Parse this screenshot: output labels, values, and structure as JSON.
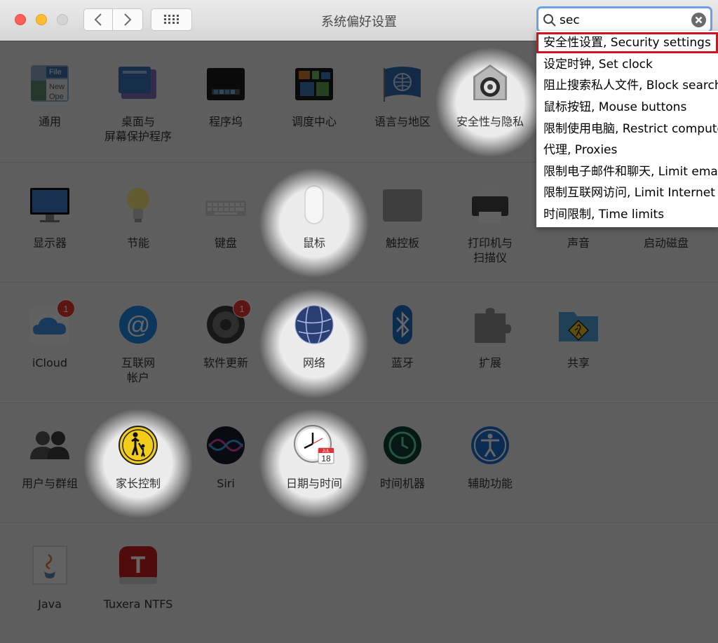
{
  "window": {
    "title": "系统偏好设置"
  },
  "search": {
    "value": "sec"
  },
  "results": [
    "安全性设置, Security settings",
    "设定时钟, Set clock",
    "阻止搜索私人文件, Block searches of private files",
    "鼠标按钮, Mouse buttons",
    "限制使用电脑, Restrict computer use",
    "代理, Proxies",
    "限制电子邮件和聊天, Limit email and chat",
    "限制互联网访问, Limit Internet access",
    "时间限制, Time limits"
  ],
  "rows": [
    {
      "items": [
        {
          "label": "通用",
          "icon": "general-icon",
          "highlight": false
        },
        {
          "label": "桌面与\n屏幕保护程序",
          "icon": "desktop-screensaver-icon",
          "highlight": false
        },
        {
          "label": "程序坞",
          "icon": "dock-icon",
          "highlight": false
        },
        {
          "label": "调度中心",
          "icon": "mission-control-icon",
          "highlight": false
        },
        {
          "label": "语言与地区",
          "icon": "language-region-icon",
          "highlight": false
        },
        {
          "label": "安全性与隐私",
          "icon": "security-privacy-icon",
          "highlight": true
        }
      ]
    },
    {
      "items": [
        {
          "label": "显示器",
          "icon": "displays-icon",
          "highlight": false
        },
        {
          "label": "节能",
          "icon": "energy-saver-icon",
          "highlight": false
        },
        {
          "label": "键盘",
          "icon": "keyboard-icon",
          "highlight": false
        },
        {
          "label": "鼠标",
          "icon": "mouse-icon",
          "highlight": true
        },
        {
          "label": "触控板",
          "icon": "trackpad-icon",
          "highlight": false
        },
        {
          "label": "打印机与\n扫描仪",
          "icon": "printers-scanners-icon",
          "highlight": false
        },
        {
          "label": "声音",
          "icon": "sound-icon",
          "highlight": false
        },
        {
          "label": "启动磁盘",
          "icon": "startup-disk-icon",
          "highlight": false
        }
      ]
    },
    {
      "items": [
        {
          "label": "iCloud",
          "icon": "icloud-icon",
          "badge": "1",
          "highlight": false
        },
        {
          "label": "互联网\n帐户",
          "icon": "internet-accounts-icon",
          "highlight": false
        },
        {
          "label": "软件更新",
          "icon": "software-update-icon",
          "badge": "1",
          "highlight": false
        },
        {
          "label": "网络",
          "icon": "network-icon",
          "highlight": true
        },
        {
          "label": "蓝牙",
          "icon": "bluetooth-icon",
          "highlight": false
        },
        {
          "label": "扩展",
          "icon": "extensions-icon",
          "highlight": false
        },
        {
          "label": "共享",
          "icon": "sharing-icon",
          "highlight": false
        }
      ]
    },
    {
      "items": [
        {
          "label": "用户与群组",
          "icon": "users-groups-icon",
          "highlight": false
        },
        {
          "label": "家长控制",
          "icon": "parental-controls-icon",
          "highlight": true
        },
        {
          "label": "Siri",
          "icon": "siri-icon",
          "highlight": false
        },
        {
          "label": "日期与时间",
          "icon": "date-time-icon",
          "highlight": true
        },
        {
          "label": "时间机器",
          "icon": "time-machine-icon",
          "highlight": false
        },
        {
          "label": "辅助功能",
          "icon": "accessibility-icon",
          "highlight": false
        }
      ]
    },
    {
      "items": [
        {
          "label": "Java",
          "icon": "java-icon",
          "highlight": false
        },
        {
          "label": "Tuxera NTFS",
          "icon": "tuxera-ntfs-icon",
          "highlight": false
        }
      ]
    }
  ],
  "calendar": {
    "month": "JUL",
    "day": "18"
  },
  "colors": {
    "highlight_outline": "#d0131e",
    "search_focus": "#6ea0e4"
  }
}
